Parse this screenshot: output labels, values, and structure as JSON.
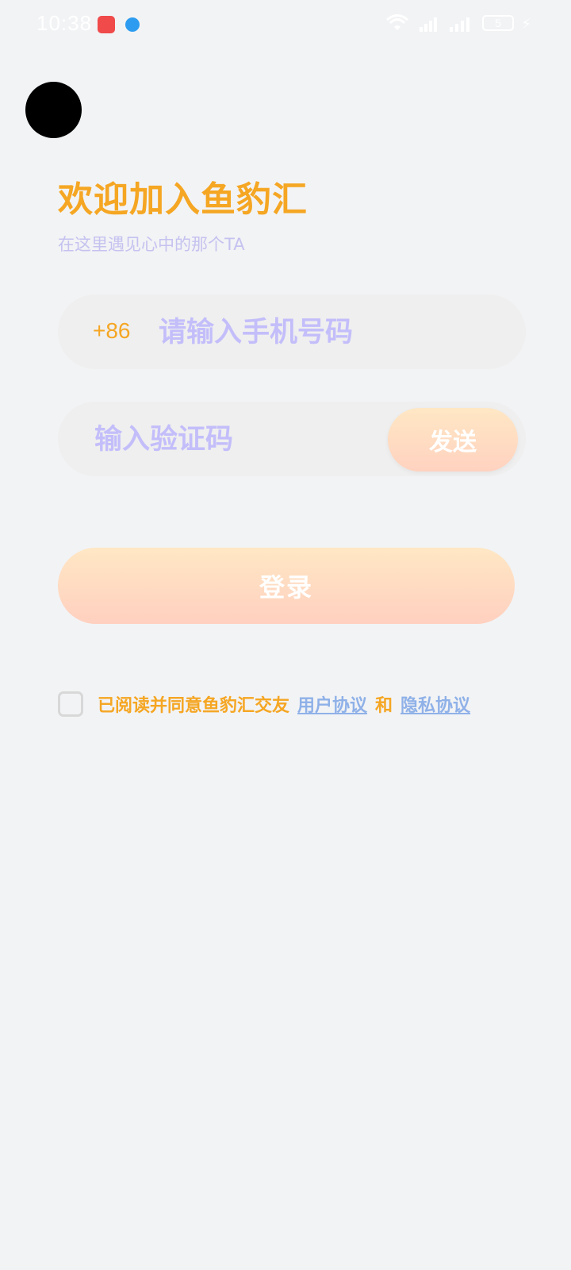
{
  "status_bar": {
    "time": "10:38",
    "battery": "5",
    "icons": [
      "app-notification-icon",
      "browser-icon",
      "wifi-icon",
      "signal-icon",
      "signal-icon",
      "battery-icon",
      "charging-icon"
    ]
  },
  "header": {
    "title": "欢迎加入鱼豹汇",
    "subtitle": "在这里遇见心中的那个TA"
  },
  "form": {
    "country_code": "+86",
    "phone_placeholder": "请输入手机号码",
    "code_placeholder": "输入验证码",
    "send_label": "发送",
    "login_label": "登录"
  },
  "agreement": {
    "checked": false,
    "prefix": "已阅读并同意鱼豹汇交友",
    "user_agreement": "用户协议",
    "and": "和",
    "privacy_policy": "隐私协议"
  },
  "colors": {
    "accent": "#f5a623",
    "placeholder": "#c3befa",
    "link": "#8fb1e8",
    "background": "#f2f3f5"
  }
}
